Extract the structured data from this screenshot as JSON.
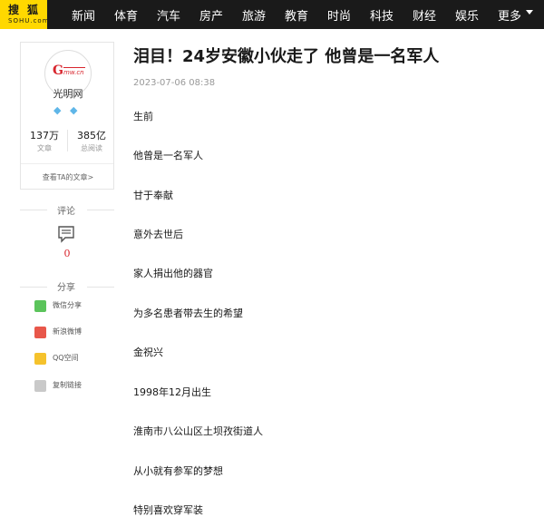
{
  "nav": {
    "logo_cn": "搜狐",
    "logo_en": "SOHU.com",
    "items": [
      "新闻",
      "体育",
      "汽车",
      "房产",
      "旅游",
      "教育",
      "时尚",
      "科技",
      "财经",
      "娱乐",
      "更多"
    ]
  },
  "author": {
    "avatar_text": "G",
    "avatar_sub": "mw.cn",
    "name": "光明网",
    "stats": [
      {
        "value": "137万",
        "label": "文章"
      },
      {
        "value": "385亿",
        "label": "总阅读"
      }
    ],
    "view_articles": "查看TA的文章>"
  },
  "comments": {
    "title": "评论",
    "count": "0"
  },
  "share": {
    "title": "分享",
    "items": [
      {
        "label": "微信分享",
        "color": "#5bc45b"
      },
      {
        "label": "新浪微博",
        "color": "#e8574a"
      },
      {
        "label": "QQ空间",
        "color": "#f5c22c"
      },
      {
        "label": "复制链接",
        "color": "#c9c9c9"
      }
    ]
  },
  "article": {
    "title": "泪目！24岁安徽小伙走了 他曾是一名军人",
    "date": "2023-07-06 08:38",
    "paragraphs": [
      "生前",
      "他曾是一名军人",
      "甘于奉献",
      "意外去世后",
      "家人捐出他的器官",
      "为多名患者带去生的希望",
      "金祝兴",
      "1998年12月出生",
      "淮南市八公山区土坝孜街道人",
      "从小就有参军的梦想",
      "特别喜欢穿军装"
    ]
  },
  "colors": {
    "nav_bg": "#1a1a1a",
    "logo_bg": "#ffd800",
    "accent_red": "#d8262e"
  },
  "icons": {
    "comment": "comment-icon",
    "badge": "diamond-badge-icon"
  }
}
